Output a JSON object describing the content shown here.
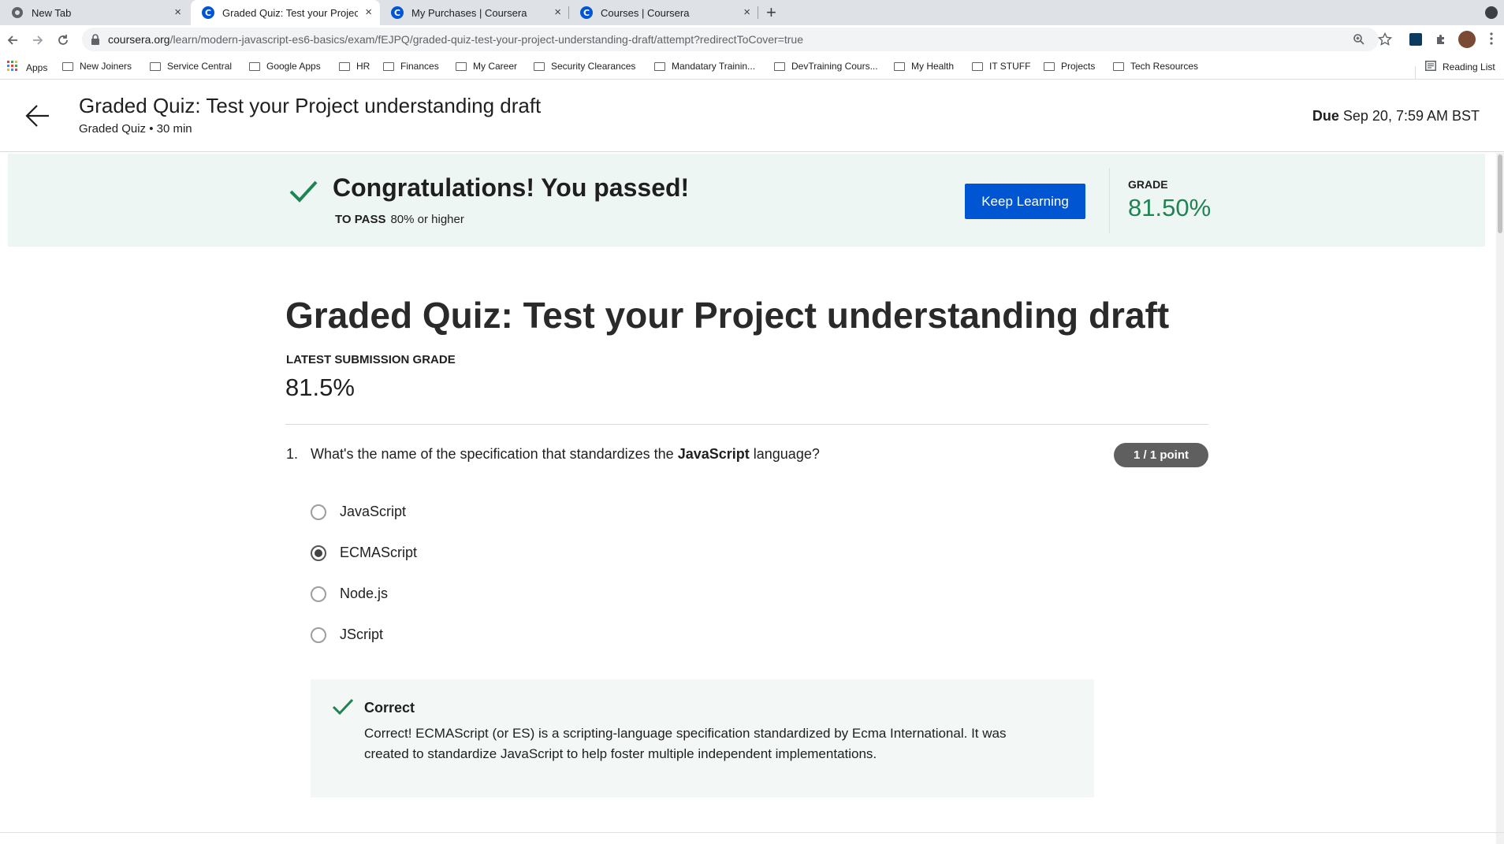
{
  "browser": {
    "tabs": [
      {
        "title": "New Tab",
        "close": "×"
      },
      {
        "title": "Graded Quiz: Test your Project",
        "close": "×"
      },
      {
        "title": "My Purchases | Coursera",
        "close": "×"
      },
      {
        "title": "Courses | Coursera",
        "close": "×"
      }
    ],
    "new_tab": "+",
    "url_host": "coursera.org",
    "url_path": "/learn/modern-javascript-es6-basics/exam/fEJPQ/graded-quiz-test-your-project-understanding-draft/attempt?redirectToCover=true",
    "bookmarks": [
      "Apps",
      "New Joiners",
      "Service Central",
      "Google Apps",
      "HR",
      "Finances",
      "My Career",
      "Security Clearances",
      "Mandatary Trainin...",
      "DevTraining Cours...",
      "My Health",
      "IT STUFF",
      "Projects",
      "Tech Resources"
    ],
    "reading_list": "Reading List"
  },
  "header": {
    "title": "Graded Quiz: Test your Project understanding draft",
    "subtitle": "Graded Quiz • 30 min",
    "due_label": "Due",
    "due_value": "Sep 20, 7:59 AM BST"
  },
  "banner": {
    "message": "Congratulations! You passed!",
    "to_pass_label": "TO PASS",
    "to_pass_value": "80% or higher",
    "button": "Keep Learning",
    "grade_label": "GRADE",
    "grade_value": "81.50%"
  },
  "main": {
    "title": "Graded Quiz: Test your Project understanding draft",
    "latest_label": "LATEST SUBMISSION GRADE",
    "latest_value": "81.5%"
  },
  "question": {
    "number": "1.",
    "text_before": "What's the name of the specification that standardizes the ",
    "text_bold": "JavaScript",
    "text_after": " language?",
    "points": "1 / 1 point",
    "options": [
      "JavaScript",
      "ECMAScript",
      "Node.js",
      "JScript"
    ],
    "selected_index": 1,
    "feedback_title": "Correct",
    "feedback_line1": "Correct! ECMAScript (or ES) is a scripting-language specification standardized by Ecma International. It was",
    "feedback_line2": "created to standardize JavaScript to help foster multiple independent implementations."
  },
  "colors": {
    "accent": "#0056d2",
    "success": "#1f8354",
    "banner_bg": "#eef6f3"
  }
}
